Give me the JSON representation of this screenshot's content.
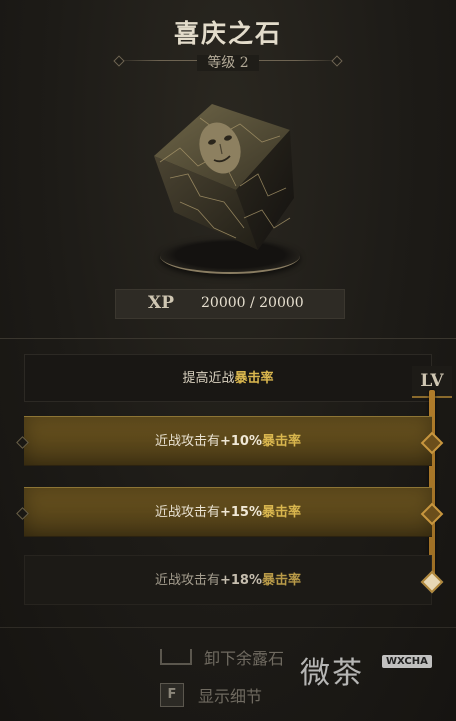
{
  "item": {
    "title": "喜庆之石",
    "level": "等级 2",
    "xp_label": "XP",
    "xp_value": "20000 / 20000"
  },
  "upgrades": {
    "header_prefix": "提高近战",
    "header_highlight": "暴击率",
    "lv_label": "LV",
    "tiers": [
      {
        "prefix": "近战攻击有",
        "value": "+10%",
        "suffix": "暴击率"
      },
      {
        "prefix": "近战攻击有",
        "value": "+15%",
        "suffix": "暴击率"
      },
      {
        "prefix": "近战攻击有",
        "value": "+18%",
        "suffix": "暴击率"
      }
    ]
  },
  "actions": {
    "unequip_label": "卸下余露石",
    "details_key": "F",
    "details_label": "显示细节"
  },
  "watermark": {
    "text": "微茶",
    "badge": "WXCHA"
  },
  "colors": {
    "accent_gold": "#d9b64e",
    "row_gold": "#6b5420",
    "track": "#b07c2a"
  }
}
